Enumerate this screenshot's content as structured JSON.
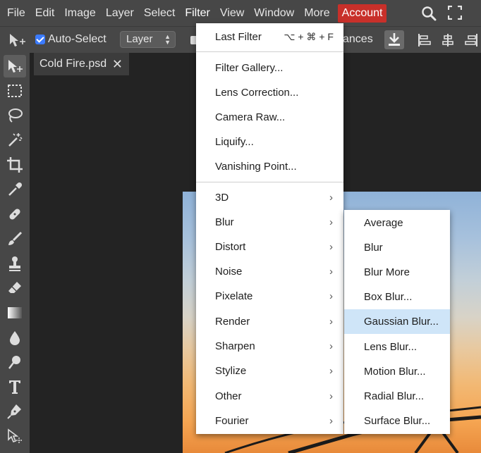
{
  "menubar": {
    "items": [
      "File",
      "Edit",
      "Image",
      "Layer",
      "Select",
      "Filter",
      "View",
      "Window",
      "More"
    ],
    "account_label": "Account",
    "icons": [
      "search-icon",
      "fullscreen-icon"
    ]
  },
  "options_bar": {
    "auto_select_label": "Auto-Select",
    "auto_select_checked": true,
    "layer_select_value": "Layer",
    "partial_label": "ances"
  },
  "document": {
    "tab_title": "Cold Fire.psd",
    "close_glyph": "✕"
  },
  "toolbar": {
    "tools": [
      "move-tool",
      "marquee-tool",
      "lasso-tool",
      "magic-wand-tool",
      "crop-tool",
      "eyedropper-tool",
      "healing-tool",
      "brush-tool",
      "stamp-tool",
      "eraser-tool",
      "gradient-tool",
      "blur-tool",
      "dodge-tool",
      "type-tool",
      "pen-tool",
      "path-select-tool"
    ]
  },
  "filter_menu": {
    "last_filter": {
      "label": "Last Filter",
      "shortcut": "⌥ + ⌘ + F"
    },
    "group1": [
      "Filter Gallery...",
      "Lens Correction...",
      "Camera Raw...",
      "Liquify...",
      "Vanishing Point..."
    ],
    "submenus": [
      "3D",
      "Blur",
      "Distort",
      "Noise",
      "Pixelate",
      "Render",
      "Sharpen",
      "Stylize",
      "Other",
      "Fourier"
    ],
    "chevron": "›"
  },
  "blur_submenu": {
    "items": [
      "Average",
      "Blur",
      "Blur More",
      "Box Blur...",
      "Gaussian Blur...",
      "Lens Blur...",
      "Motion Blur...",
      "Radial Blur...",
      "Surface Blur..."
    ],
    "highlighted": "Gaussian Blur..."
  }
}
